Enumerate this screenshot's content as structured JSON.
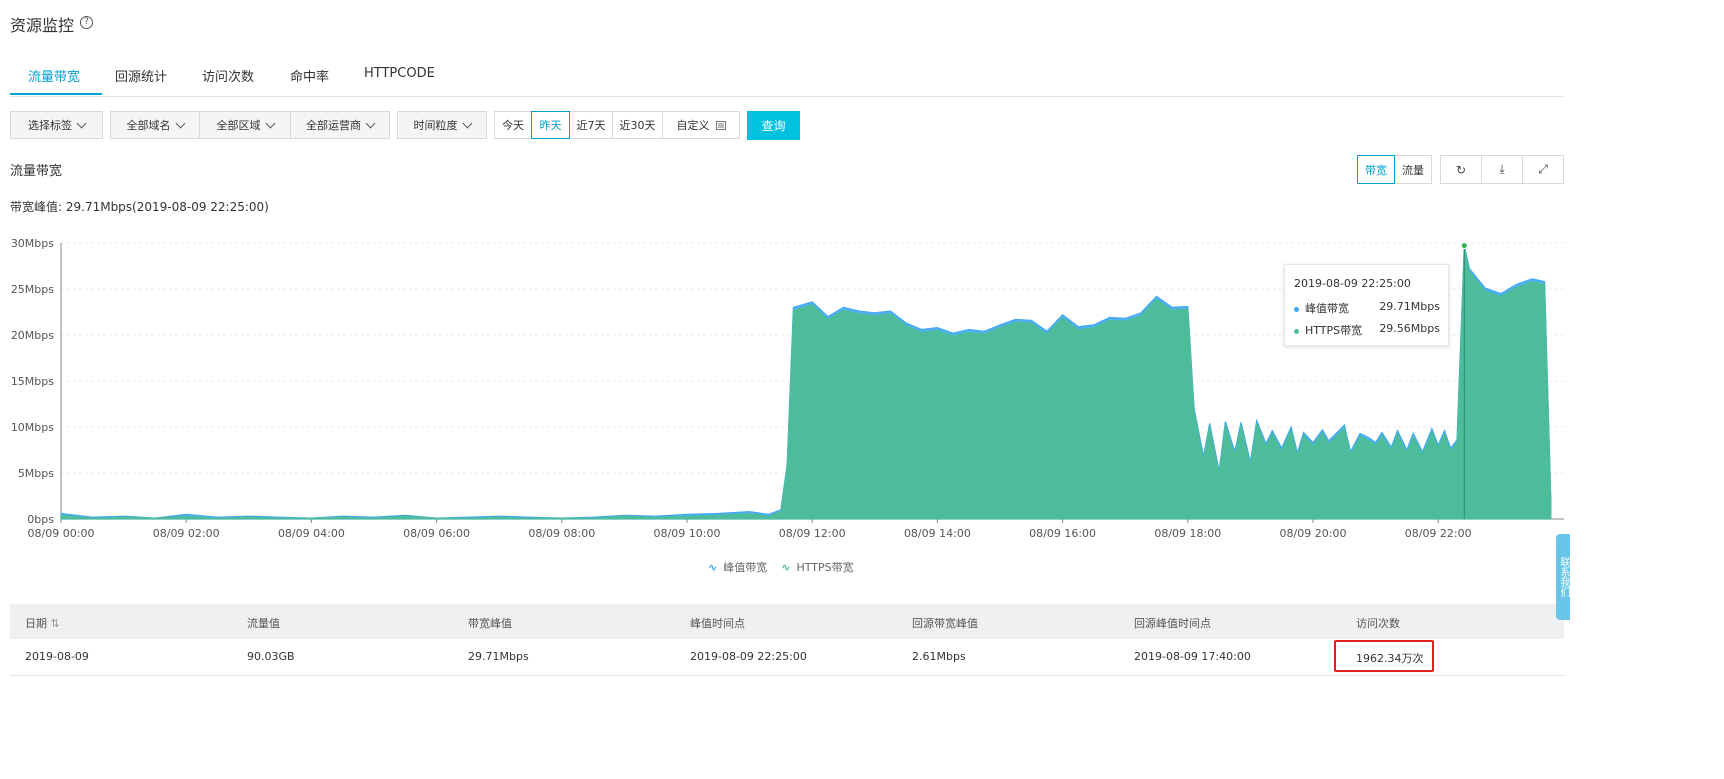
{
  "header": {
    "title": "资源监控",
    "help_icon": "?"
  },
  "tabs": [
    {
      "label": "流量带宽",
      "active": true
    },
    {
      "label": "回源统计"
    },
    {
      "label": "访问次数"
    },
    {
      "label": "命中率"
    },
    {
      "label": "HTTPCODE"
    }
  ],
  "filters": {
    "tag": "选择标签",
    "domain": "全部域名",
    "region": "全部区域",
    "isp": "全部运营商",
    "granularity": "时间粒度",
    "ranges": [
      "今天",
      "昨天",
      "近7天",
      "近30天"
    ],
    "active_range": "昨天",
    "custom": "自定义",
    "query": "查询"
  },
  "section": {
    "title": "流量带宽",
    "peak_label": "带宽峰值: 29.71Mbps(2019-08-09 22:25:00)",
    "toggle": [
      "带宽",
      "流量"
    ],
    "toggle_active": "带宽"
  },
  "chart_data": {
    "type": "area",
    "title": "",
    "xlabel": "",
    "ylabel": "",
    "y_ticks": [
      "0bps",
      "5Mbps",
      "10Mbps",
      "15Mbps",
      "20Mbps",
      "25Mbps",
      "30Mbps"
    ],
    "x_ticks": [
      "08/09 00:00",
      "08/09 02:00",
      "08/09 04:00",
      "08/09 06:00",
      "08/09 08:00",
      "08/09 10:00",
      "08/09 12:00",
      "08/09 14:00",
      "08/09 16:00",
      "08/09 18:00",
      "08/09 20:00",
      "08/09 22:00"
    ],
    "ylim": [
      0,
      30
    ],
    "y_unit": "Mbps",
    "grid": true,
    "legend_position": "bottom",
    "x": [
      0,
      0.5,
      1,
      1.5,
      2,
      2.5,
      3,
      3.5,
      4,
      4.5,
      5,
      5.5,
      6,
      6.5,
      7,
      7.5,
      8,
      8.5,
      9,
      9.5,
      10,
      10.5,
      11,
      11.3,
      11.5,
      11.6,
      11.7,
      12,
      12.25,
      12.5,
      12.75,
      13,
      13.25,
      13.5,
      13.75,
      14,
      14.25,
      14.5,
      14.75,
      15,
      15.25,
      15.5,
      15.75,
      16,
      16.25,
      16.5,
      16.75,
      17,
      17.25,
      17.5,
      17.75,
      18,
      18.1,
      18.25,
      18.35,
      18.5,
      18.6,
      18.75,
      18.85,
      19,
      19.1,
      19.25,
      19.35,
      19.5,
      19.65,
      19.75,
      19.85,
      20,
      20.15,
      20.25,
      20.4,
      20.5,
      20.6,
      20.75,
      20.9,
      21,
      21.1,
      21.25,
      21.35,
      21.5,
      21.6,
      21.75,
      21.9,
      22,
      22.1,
      22.2,
      22.3,
      22.417,
      22.5,
      22.75,
      23,
      23.25,
      23.5,
      23.7,
      23.8
    ],
    "series": [
      {
        "name": "峰值带宽",
        "color": "#3fa8f4",
        "values": [
          0.6,
          0.2,
          0.3,
          0.1,
          0.5,
          0.2,
          0.3,
          0.2,
          0.1,
          0.3,
          0.2,
          0.4,
          0.1,
          0.2,
          0.3,
          0.2,
          0.1,
          0.2,
          0.4,
          0.3,
          0.5,
          0.6,
          0.8,
          0.5,
          1,
          6,
          23,
          23.6,
          22,
          23,
          22.6,
          22.4,
          22.6,
          21.3,
          20.6,
          20.8,
          20.2,
          20.6,
          20.4,
          21.1,
          21.7,
          21.6,
          20.4,
          22.2,
          20.9,
          21.1,
          21.9,
          21.8,
          22.4,
          24.2,
          23,
          23.1,
          12,
          6.8,
          10.4,
          5.2,
          10.6,
          7.3,
          10.5,
          6.2,
          10.7,
          8.2,
          9.6,
          7.7,
          10,
          7.2,
          9.4,
          8.3,
          9.7,
          8.5,
          9.5,
          10.2,
          7.3,
          9.3,
          8.8,
          8.3,
          9.4,
          7.8,
          9.6,
          7.5,
          9.3,
          7.3,
          9.8,
          8,
          9.6,
          7.7,
          8.6,
          29.71,
          27.2,
          25.1,
          24.5,
          25.5,
          26.1,
          25.8,
          2
        ]
      },
      {
        "name": "HTTPS带宽",
        "color": "#4cbc9a",
        "values": [
          0.4,
          0.1,
          0.2,
          0.1,
          0.3,
          0.1,
          0.2,
          0.1,
          0.1,
          0.2,
          0.1,
          0.3,
          0.1,
          0.1,
          0.2,
          0.1,
          0.1,
          0.1,
          0.3,
          0.2,
          0.3,
          0.4,
          0.6,
          0.3,
          0.8,
          5.8,
          22.7,
          23.3,
          21.7,
          22.7,
          22.3,
          22.1,
          22.3,
          21,
          20.3,
          20.5,
          19.9,
          20.3,
          20.1,
          20.8,
          21.4,
          21.3,
          20.1,
          21.9,
          20.6,
          20.8,
          21.6,
          21.5,
          22.1,
          23.9,
          22.7,
          22.8,
          11.7,
          6.5,
          10.1,
          4.9,
          10.3,
          7,
          10.2,
          5.9,
          10.4,
          7.9,
          9.3,
          7.4,
          9.7,
          6.9,
          9.1,
          8,
          9.4,
          8.2,
          9.2,
          9.9,
          7,
          9,
          8.5,
          8,
          9.1,
          7.5,
          9.3,
          7.2,
          9,
          7,
          9.5,
          7.7,
          9.3,
          7.4,
          8.3,
          29.56,
          26.9,
          24.8,
          24.2,
          25.2,
          25.8,
          25.5,
          1.8
        ]
      }
    ],
    "tooltip": {
      "time": "2019-08-09 22:25:00",
      "rows": [
        {
          "name": "峰值带宽",
          "value": "29.71Mbps",
          "color": "#3fa8f4"
        },
        {
          "name": "HTTPS带宽",
          "value": "29.56Mbps",
          "color": "#4cbc9a"
        }
      ]
    }
  },
  "legend": {
    "items": [
      "峰值带宽",
      "HTTPS带宽"
    ]
  },
  "table": {
    "columns": [
      "日期",
      "流量值",
      "带宽峰值",
      "峰值时间点",
      "回源带宽峰值",
      "回源峰值时间点",
      "访问次数"
    ],
    "rows": [
      [
        "2019-08-09",
        "90.03GB",
        "29.71Mbps",
        "2019-08-09 22:25:00",
        "2.61Mbps",
        "2019-08-09 17:40:00",
        "1962.34万次"
      ]
    ]
  },
  "side_widget": {
    "label": "联系我们"
  }
}
